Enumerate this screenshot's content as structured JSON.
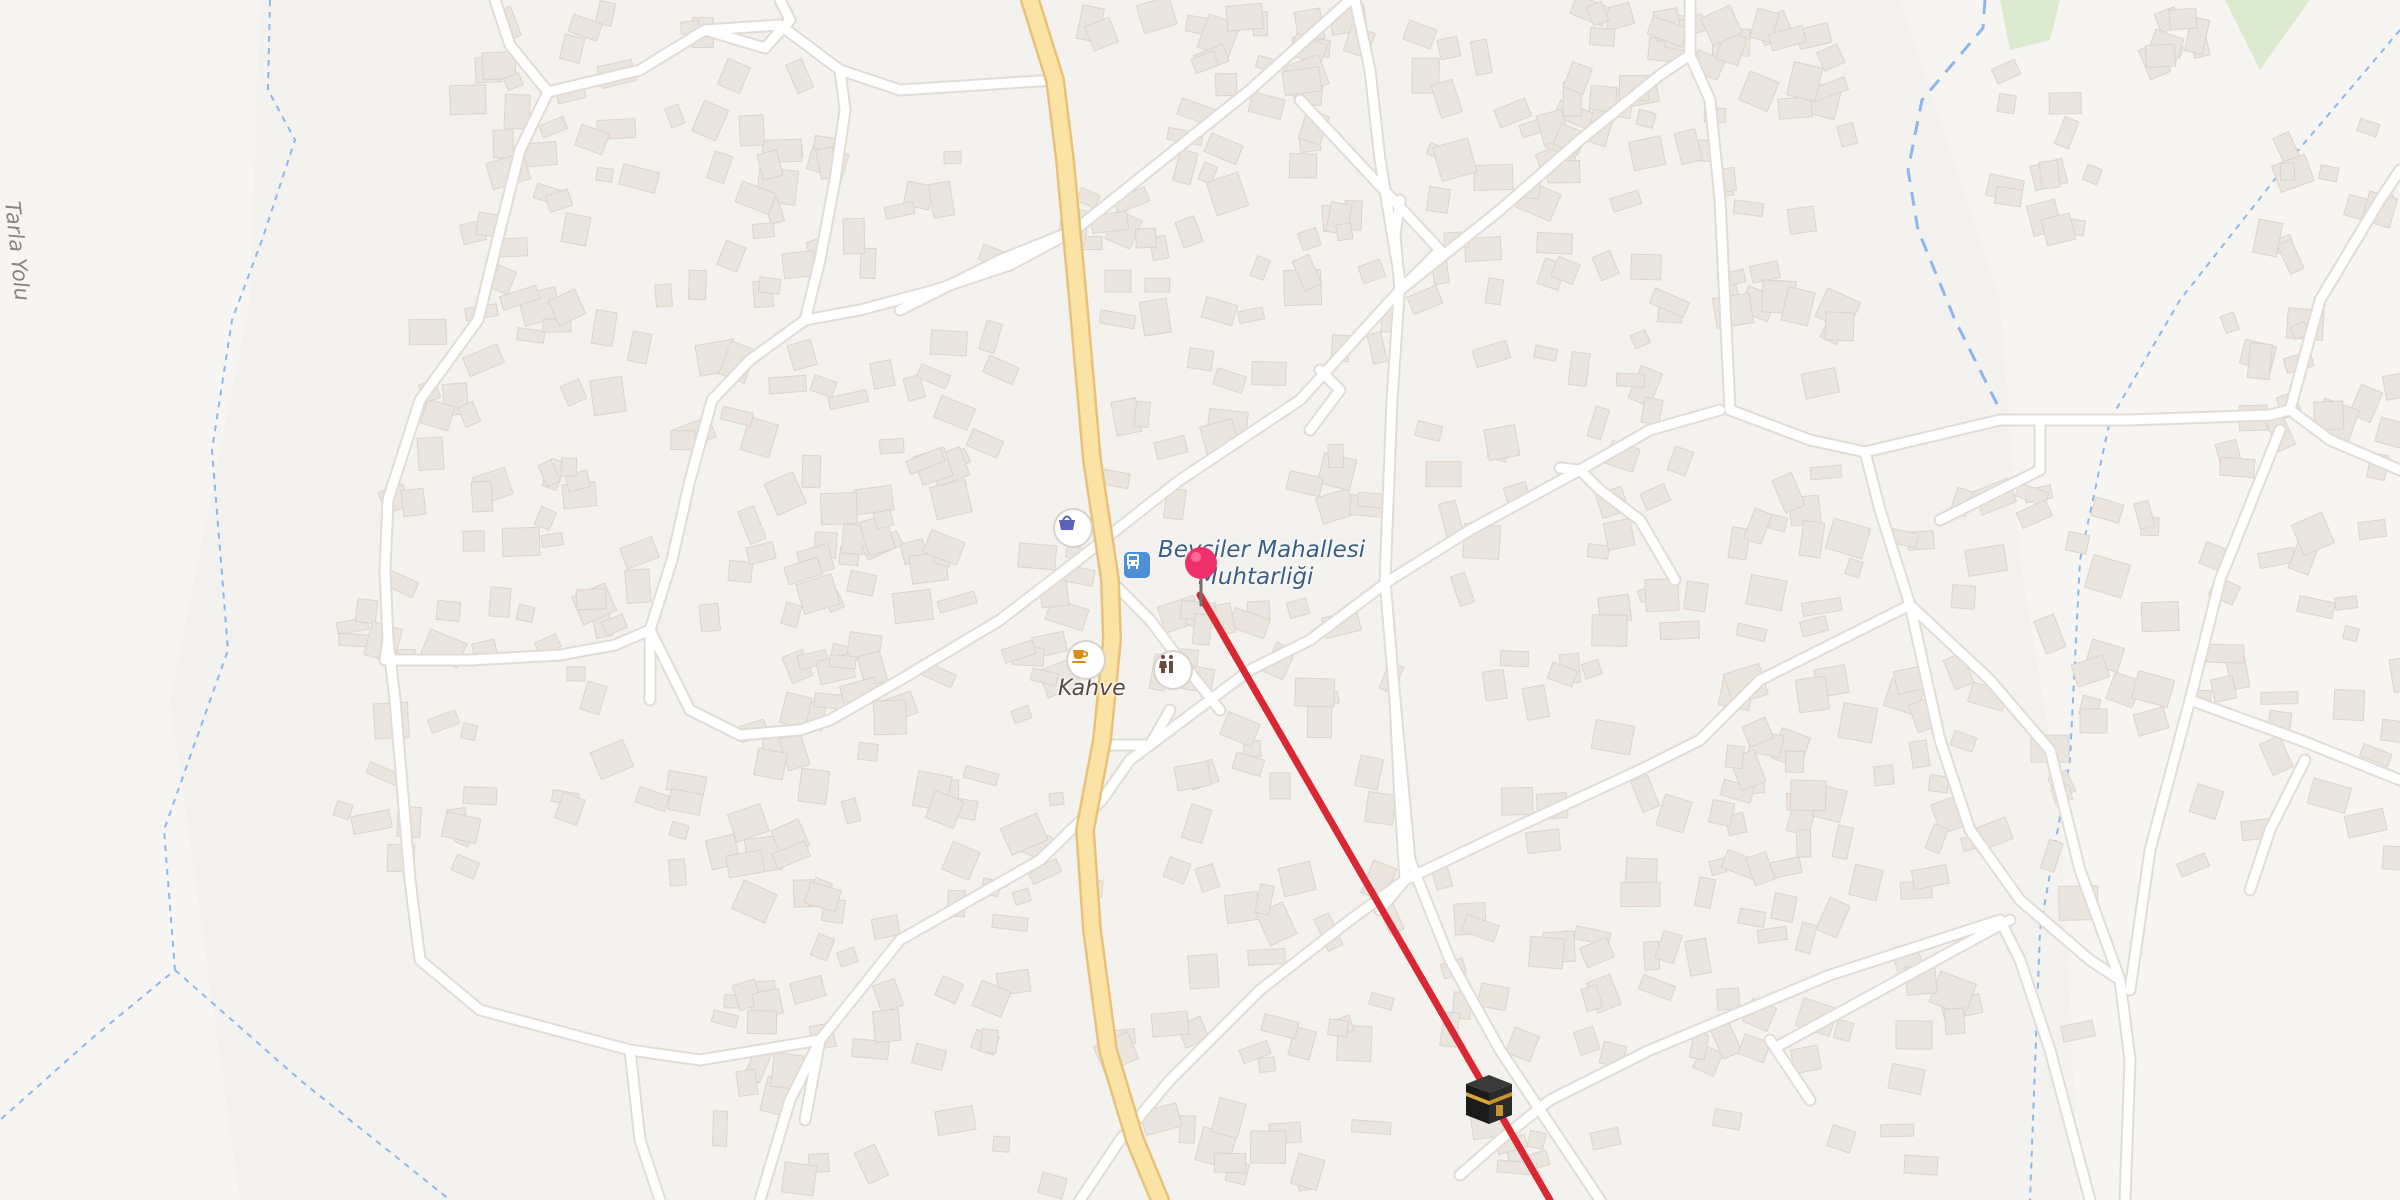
{
  "map": {
    "colors": {
      "land": "#f4f2ef",
      "building": "#ebe5df",
      "building_edge": "#ddd5cc",
      "road": "#ffffff",
      "road_edge": "#e1ddd6",
      "main_road": "#fbe3a6",
      "main_road_edge": "#e8c27a",
      "route": "#d92831",
      "waterway": "#8bb8ee",
      "park": "#dcebd0",
      "pin": "#f0306a"
    },
    "labels": {
      "road_farla": "Tarla Yolu",
      "cafe": "Kahve",
      "place_line1": "Beyşiler Mahallesi",
      "place_line2": "Muhtarliği"
    },
    "markers": {
      "shop": "shopping-basket-icon",
      "bus": "bus-stop-icon",
      "cafe": "coffee-cup-icon",
      "toilets": "toilets-icon",
      "pin": "location-pin-icon",
      "kaaba": "kaaba-icon"
    }
  }
}
